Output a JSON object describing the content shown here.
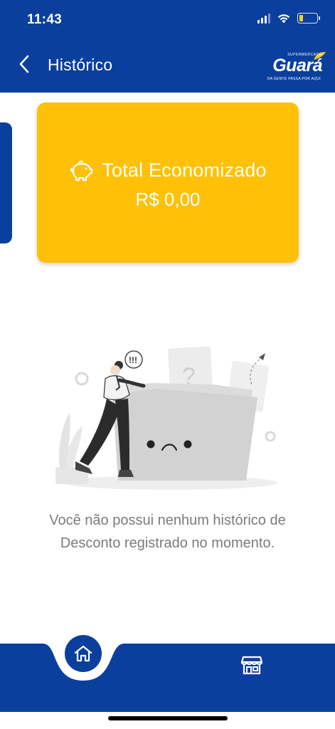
{
  "status_bar": {
    "time": "11:43",
    "icons": [
      "signal-icon",
      "wifi-icon",
      "battery-icon"
    ]
  },
  "header": {
    "title": "Histórico",
    "back_icon": "chevron-left-icon",
    "brand": {
      "super": "SUPERMERCADO",
      "name": "Guará",
      "tagline": "DA GENTE PASSA POR AQUI"
    }
  },
  "savings_card": {
    "icon": "piggy-bank-icon",
    "title": "Total Economizado",
    "value": "R$ 0,00"
  },
  "empty_state": {
    "illustration": "empty-folder-illustration",
    "message": "Você não possui nenhum histórico de Desconto registrado no momento."
  },
  "bottom_nav": {
    "items": [
      {
        "icon": "home-icon",
        "active": true
      },
      {
        "icon": "store-icon",
        "active": false
      }
    ]
  },
  "colors": {
    "primary": "#0b3f9e",
    "accent": "#ffc107",
    "muted_text": "#7b7b7b"
  }
}
